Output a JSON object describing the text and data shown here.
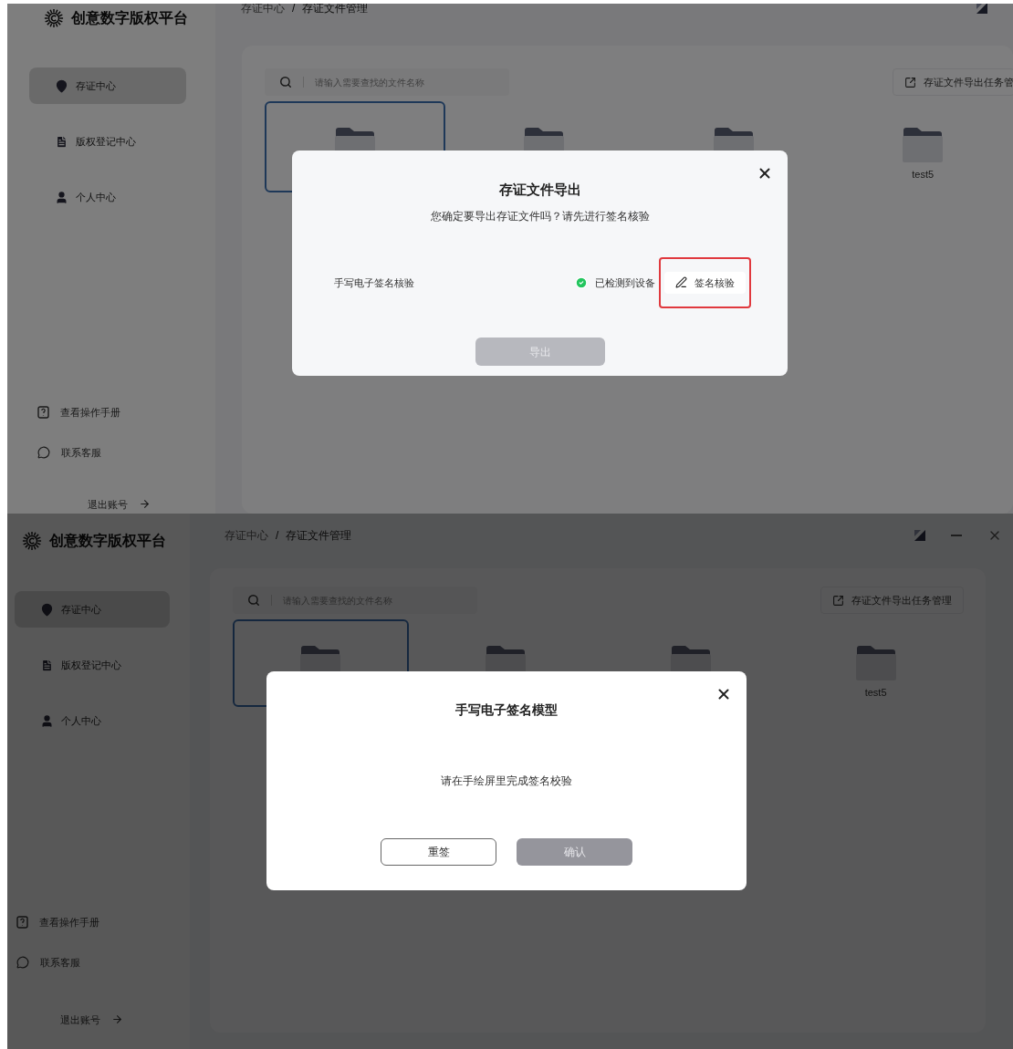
{
  "screens": [
    {
      "brand": "创意数字版权平台",
      "breadcrumb": [
        "存证中心",
        "存证文件管理"
      ],
      "breadcrumb_separator": "/",
      "nav": [
        {
          "label": "存证中心",
          "selected": true
        },
        {
          "label": "版权登记中心",
          "selected": false
        },
        {
          "label": "个人中心",
          "selected": false
        }
      ],
      "footer_links": [
        {
          "label": "查看操作手册"
        },
        {
          "label": "联系客服"
        }
      ],
      "logout": "退出账号",
      "search": {
        "placeholder": "请输入需要查找的文件名称"
      },
      "export_tasks_button": "存证文件导出任务管",
      "folders": [
        {
          "selected": true
        },
        {
          "selected": false
        },
        {
          "selected": false
        },
        {
          "selected": false,
          "label": "test5"
        }
      ],
      "modal": {
        "kind": "export",
        "title": "存证文件导出",
        "subtitle": "您确定要导出存证文件吗？请先进行签名核验",
        "row_label": "手写电子签名核验",
        "status": "已检测到设备",
        "verify_button": "签名核验",
        "verify_highlighted": true,
        "primary_button": {
          "label": "导出",
          "disabled": true
        }
      }
    },
    {
      "brand": "创意数字版权平台",
      "breadcrumb": [
        "存证中心",
        "存证文件管理"
      ],
      "breadcrumb_separator": "/",
      "nav": [
        {
          "label": "存证中心",
          "selected": true
        },
        {
          "label": "版权登记中心",
          "selected": false
        },
        {
          "label": "个人中心",
          "selected": false
        }
      ],
      "footer_links": [
        {
          "label": "查看操作手册"
        },
        {
          "label": "联系客服"
        }
      ],
      "logout": "退出账号",
      "search": {
        "placeholder": "请输入需要查找的文件名称"
      },
      "export_tasks_button": "存证文件导出任务管理",
      "folders": [
        {
          "selected": true
        },
        {
          "selected": false
        },
        {
          "selected": false
        },
        {
          "selected": false,
          "label": "test5"
        }
      ],
      "modal": {
        "kind": "signature",
        "title": "手写电子签名模型",
        "message": "请在手绘屏里完成签名校验",
        "buttons": [
          {
            "label": "重签",
            "kind": "outline",
            "disabled": false
          },
          {
            "label": "确认",
            "kind": "filled",
            "disabled": true
          }
        ]
      }
    }
  ]
}
